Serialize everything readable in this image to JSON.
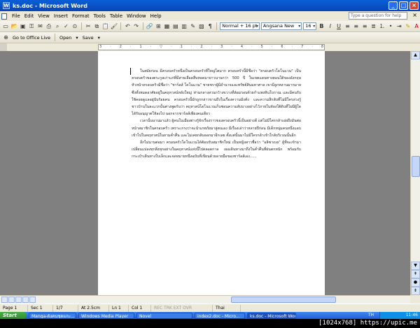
{
  "window": {
    "title": "ks.doc - Microsoft Word",
    "app_icon": "W",
    "buttons": [
      "minimize-icon",
      "maximize-icon",
      "close-icon"
    ]
  },
  "menubar": {
    "items": [
      "File",
      "Edit",
      "View",
      "Insert",
      "Format",
      "Tools",
      "Table",
      "Window",
      "Help"
    ],
    "help_placeholder": "Type a question for help",
    "close_glyph": "×"
  },
  "toolbar_standard": {
    "icons": [
      "new-icon",
      "open-icon",
      "save-icon",
      "permission-icon",
      "email-icon",
      "print-icon",
      "print-preview-icon",
      "spelling-icon",
      "research-icon",
      "cut-icon",
      "copy-icon",
      "paste-icon",
      "format-painter-icon",
      "undo-icon",
      "redo-icon",
      "hyperlink-icon",
      "tables-icon",
      "insert-table-icon",
      "excel-icon",
      "columns-icon",
      "drawing-icon",
      "document-map-icon",
      "show-hide-icon"
    ]
  },
  "toolbar_formatting": {
    "style_value": "Normal + 16 pt",
    "font_value": "Angsana New",
    "size_value": "16",
    "bold": "B",
    "italic": "I",
    "underline": "U"
  },
  "toolbar_online": {
    "office_live": "Go to Office Live",
    "open_label": "Open",
    "save_label": "Save"
  },
  "ruler": {
    "marks": "3 · 2 · 1 · ▽ · 1 · 2 · 3 · 4 · 5 · 6 · 7 · 8 · 9 · 10 · 11 · 12 · 13 · 14 · 15 · 16"
  },
  "document": {
    "paragraphs": [
      "ในสมัยก่อน มีครอบครัวหนึ่งเป็นครอบครัวที่ใหญ่โตมาก ครอบครัวนี้มีชื่อว่า \"ครอบครัวโดโนแวน\" เป็นครอบครัวของตระกูลเก่าแก่ที่มีสายเลือดสืบทอดมายาวนานกว่า 500 ปี ในเขตแดนทางตอนใต้ของอังกฤษ หัวหน้าครอบครัวมีชื่อว่า \"ชาร์ลส์ โดโนแวน\" ชายชราผู้มีอำนาจและทรัพย์สินมหาศาล เขามีลูกหลานมากมายซึ่งทั้งหมดอาศัยอยู่ในคฤหาสน์หลังใหญ่ ท่ามกลางสวนกว้างขวางที่ล้อมรอบด้วยกำแพงหินโบราณ และมีคนรับใช้คอยดูแลอยู่นับร้อยคน ครอบครัวนี้มักถูกกล่าวขานถึงในเรื่องความมั่งคั่ง และความลึกลับที่ไม่มีใครล่วงรู้ ชาวบ้านในละแวกนั้นต่างพูดกันว่า คฤหาสน์โดโนแวนเก็บซ่อนความลับบางอย่างไว้ภายในห้องใต้ดินที่ไม่มีผู้ใดได้รับอนุญาตให้ลงไป นอกจากชาร์ลส์เพียงคนเดียว",
      "เวลานั้นนานมาแล้ว ผู้คนในเมืองต่างรู้จักเรื่องราวของครอบครัวนี้เป็นอย่างดี แต่ไม่มีใครกล้าเอ่ยถึงมันต่อหน้าสมาชิกในครอบครัว เพราะเกรงว่าจะนำเภทภัยมาสู่ตนเอง มีเรื่องเล่าว่าหลายปีก่อน มีเด็กหนุ่มคนหนึ่งแอบเข้าไปในคฤหาสน์ในยามค่ำคืน และไม่เคยกลับออกมาอีกเลย ตั้งแต่นั้นมาไม่มีใครกล้าเข้าใกล้บริเวณนั้นอีก",
      "อีกไม่นานต่อมา ครอบครัวโดโนแวนได้ต้อนรับสมาชิกใหม่ เป็นหญิงสาวชื่อว่า \"อลิซาเบธ\" ผู้ที่จะเข้ามาเปลี่ยนแปลงทุกสิ่งทุกอย่างในคฤหาสน์แห่งนี้ไปตลอดกาล เธอเดินทางมาถึงในค่ำคืนที่ฝนตกหนัก พร้อมกับกระเป๋าเดินทางใบเล็กและจดหมายหนึ่งฉบับที่เขียนด้วยลายมือของชาร์ลส์เอง......"
    ]
  },
  "statusbar": {
    "page": "Page 1",
    "sec": "Sec 1",
    "pages": "1/7",
    "at": "At 2.5cm",
    "ln": "Ln 1",
    "col": "Col 1",
    "modes": "REC  TRK  EXT  OVR",
    "language": "Thai"
  },
  "taskbar": {
    "start": "Start",
    "tasks": [
      "Manga-ดังคนชุดแกะ...",
      "Windows Media Player",
      "Novel",
      "index2.doc - Micro...",
      "ks.doc - Microsoft Word"
    ],
    "lang": "TH",
    "clock": "11:46"
  },
  "watermark": "[1024x768] https://upic.me"
}
